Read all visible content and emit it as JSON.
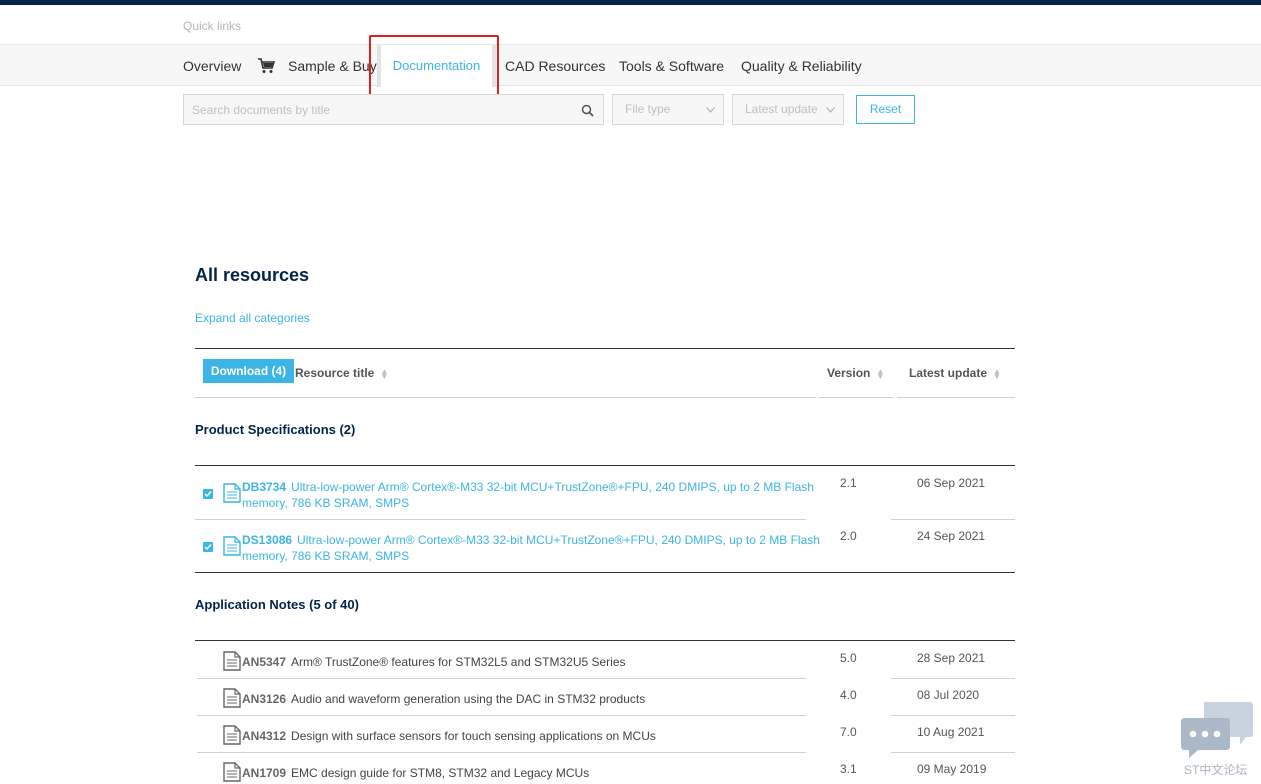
{
  "quick_links": "Quick links",
  "nav": {
    "overview": "Overview",
    "sample_buy": "Sample & Buy",
    "documentation": "Documentation",
    "cad_resources": "CAD Resources",
    "tools_software": "Tools & Software",
    "quality_reliability": "Quality & Reliability"
  },
  "filters": {
    "search_placeholder": "Search documents by title",
    "file_type": "File type",
    "latest_update": "Latest update",
    "reset": "Reset"
  },
  "resources": {
    "title": "All resources",
    "expand_all": "Expand all categories",
    "download_button": "Download (4)",
    "columns": {
      "title": "Resource title",
      "version": "Version",
      "latest_update": "Latest update"
    }
  },
  "categories": [
    {
      "title": "Product Specifications (2)",
      "rows": [
        {
          "code": "DB3734",
          "title_line1": "Ultra-low-power Arm® Cortex®-M33 32-bit MCU+TrustZone®+FPU, 240 DMIPS, up to 2 MB Flash",
          "title_line2": "memory, 786 KB SRAM, SMPS",
          "version": "2.1",
          "date": "06 Sep 2021",
          "checked": true
        },
        {
          "code": "DS13086",
          "title_line1": "Ultra-low-power Arm® Cortex®-M33 32-bit MCU+TrustZone®+FPU, 240 DMIPS, up to 2 MB Flash",
          "title_line2": "memory, 786 KB SRAM, SMPS",
          "version": "2.0",
          "date": "24 Sep 2021",
          "checked": true
        }
      ]
    },
    {
      "title": "Application Notes (5 of 40)",
      "rows": [
        {
          "code": "AN5347",
          "title": "Arm® TrustZone® features for STM32L5 and STM32U5 Series",
          "version": "5.0",
          "date": "28 Sep 2021"
        },
        {
          "code": "AN3126",
          "title": "Audio and waveform generation using the DAC in STM32 products",
          "version": "4.0",
          "date": "08 Jul 2020"
        },
        {
          "code": "AN4312",
          "title": "Design with surface sensors for touch sensing applications on MCUs",
          "version": "7.0",
          "date": "10 Aug 2021"
        },
        {
          "code": "AN1709",
          "title": "EMC design guide for STM8, STM32 and Legacy MCUs",
          "version": "3.1",
          "date": "09 May 2019"
        }
      ]
    }
  ],
  "chat_widget": {
    "label": "ST中文论坛",
    "icon": "chat-bubbles-icon"
  },
  "colors": {
    "accent": "#3cb4e6",
    "navy": "#03234b",
    "highlight": "#e0201a"
  }
}
